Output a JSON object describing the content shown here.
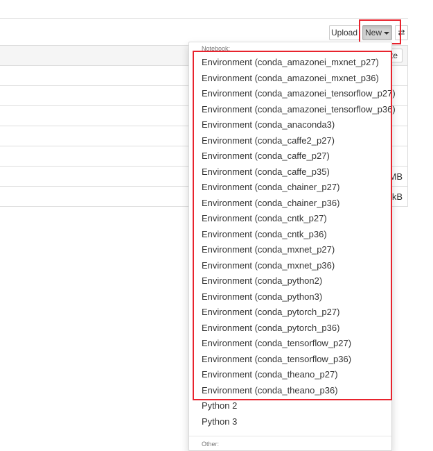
{
  "toolbar": {
    "upload_label": "Upload",
    "new_label": "New",
    "refresh_icon": "refresh-icon",
    "refresh_glyph": "⇄"
  },
  "list_header": {
    "hidden_button_label": "te"
  },
  "file_rows": [
    {
      "size": ""
    },
    {
      "size": ""
    },
    {
      "size": ""
    },
    {
      "size": ""
    },
    {
      "size": ""
    },
    {
      "size": "MB"
    },
    {
      "size": "kB"
    }
  ],
  "dropdown": {
    "notebook_header": "Notebook:",
    "environments": [
      "Environment (conda_amazonei_mxnet_p27)",
      "Environment (conda_amazonei_mxnet_p36)",
      "Environment (conda_amazonei_tensorflow_p27)",
      "Environment (conda_amazonei_tensorflow_p36)",
      "Environment (conda_anaconda3)",
      "Environment (conda_caffe2_p27)",
      "Environment (conda_caffe_p27)",
      "Environment (conda_caffe_p35)",
      "Environment (conda_chainer_p27)",
      "Environment (conda_chainer_p36)",
      "Environment (conda_cntk_p27)",
      "Environment (conda_cntk_p36)",
      "Environment (conda_mxnet_p27)",
      "Environment (conda_mxnet_p36)",
      "Environment (conda_python2)",
      "Environment (conda_python3)",
      "Environment (conda_pytorch_p27)",
      "Environment (conda_pytorch_p36)",
      "Environment (conda_tensorflow_p27)",
      "Environment (conda_tensorflow_p36)",
      "Environment (conda_theano_p27)",
      "Environment (conda_theano_p36)"
    ],
    "kernels": [
      "Python 2",
      "Python 3"
    ],
    "other_header": "Other:"
  },
  "colors": {
    "highlight": "#e8232d"
  }
}
